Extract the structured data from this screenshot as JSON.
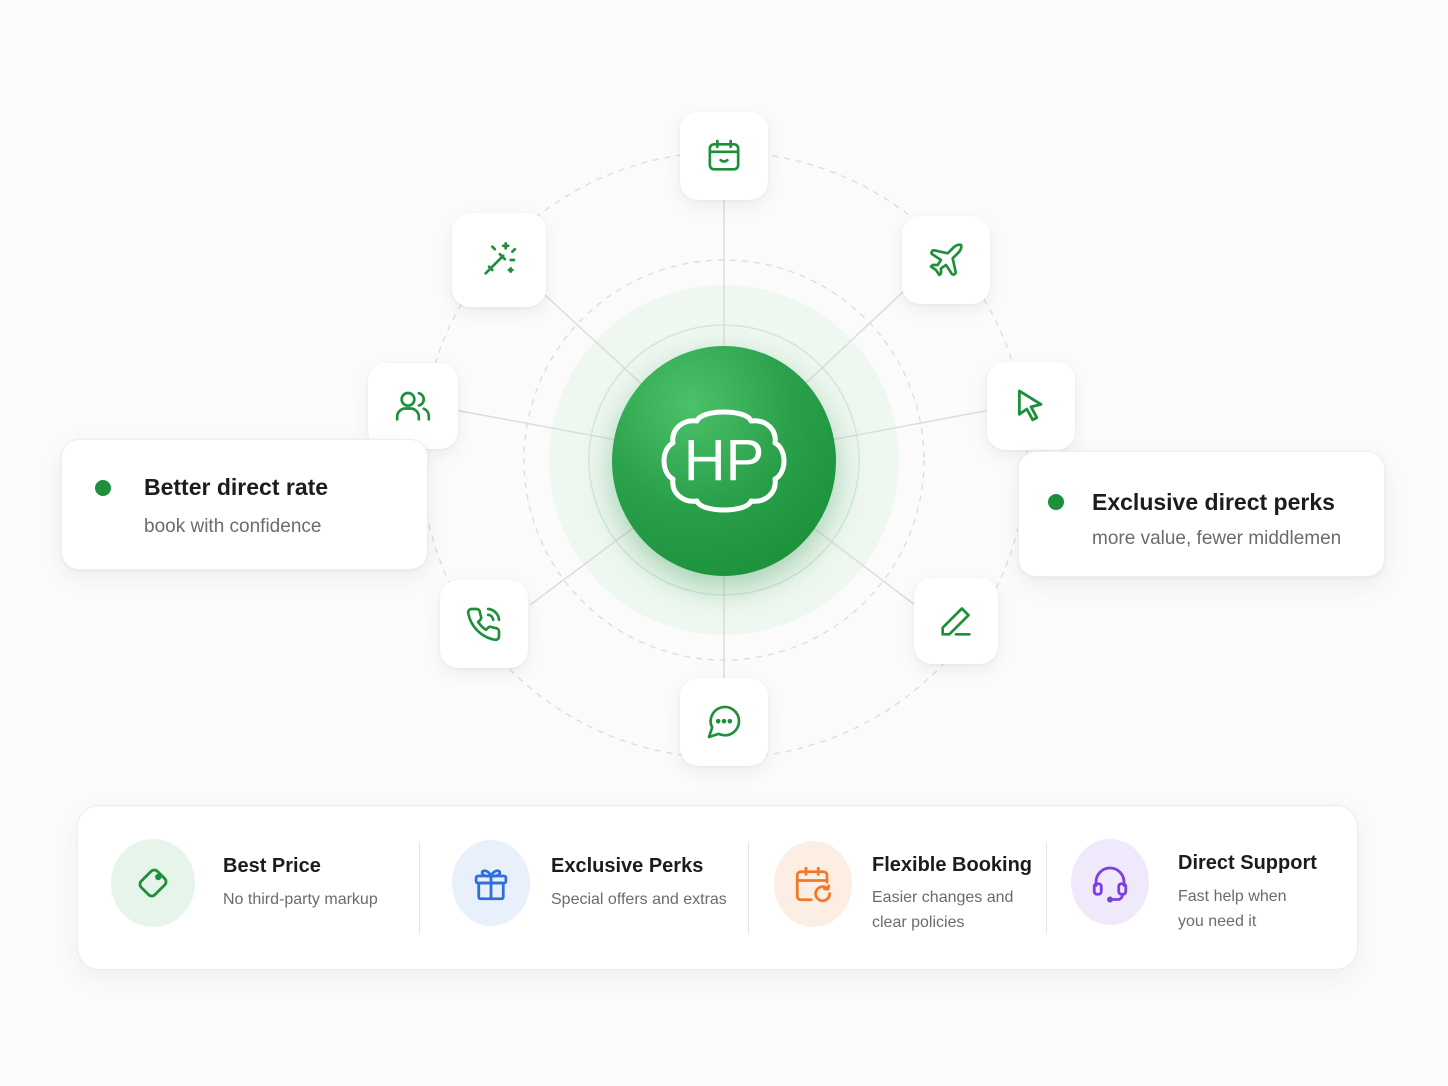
{
  "brand": {
    "logo_text": "HP",
    "accent_color": "#1e8f3a"
  },
  "orbit_nodes": [
    {
      "icon": "calendar-icon"
    },
    {
      "icon": "plane-icon"
    },
    {
      "icon": "cursor-icon"
    },
    {
      "icon": "pen-icon"
    },
    {
      "icon": "chat-icon"
    },
    {
      "icon": "phone-icon"
    },
    {
      "icon": "users-icon"
    },
    {
      "icon": "magic-wand-icon"
    }
  ],
  "callouts": {
    "left": {
      "title": "Better direct rate",
      "subtitle": "book with confidence"
    },
    "right": {
      "title": "Exclusive direct perks",
      "subtitle": "more value, fewer middlemen"
    }
  },
  "features": [
    {
      "title": "Best Price",
      "desc_line1": "No third-party markup",
      "desc_line2": "",
      "icon": "tag-icon",
      "color": "#1e8f3a",
      "bg": "#e6f4e9"
    },
    {
      "title": "Exclusive Perks",
      "desc_line1": "Special offers and extras",
      "desc_line2": "",
      "icon": "gift-icon",
      "color": "#2f6fd8",
      "bg": "#e8f0fc"
    },
    {
      "title": "Flexible Booking",
      "desc_line1": "Easier changes and",
      "desc_line2": "clear policies",
      "icon": "calendar-refresh-icon",
      "color": "#f07a2a",
      "bg": "#fdeee4"
    },
    {
      "title": "Direct Support",
      "desc_line1": "Fast help when",
      "desc_line2": "you need it",
      "icon": "headset-icon",
      "color": "#7b3fe0",
      "bg": "#f0e9fc"
    }
  ]
}
